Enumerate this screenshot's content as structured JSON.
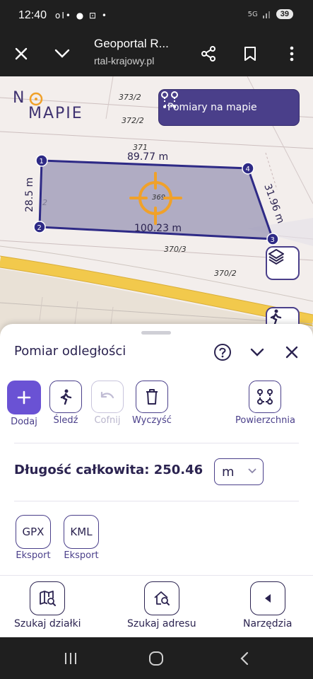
{
  "status_bar": {
    "time": "12:40",
    "left_icons": "oI• ● ⊡ •",
    "signal": "5G",
    "battery": "39"
  },
  "browser": {
    "title": "Geoportal R...",
    "url": "rtal-krajowy.pl",
    "icons": [
      "close-icon",
      "chevron-down-icon",
      "share-icon",
      "bookmark-icon",
      "more-icon"
    ]
  },
  "map": {
    "logo_n": "N",
    "logo_mapie": "MAPIE",
    "measure_button": "Pomiary na mapie",
    "parcel_labels": [
      "373/2",
      "372/2",
      "371",
      "369",
      "370/3",
      "370/2",
      "2"
    ],
    "edge_labels": [
      "89.77 m",
      "31.96 m",
      "100.23 m",
      "28.5 m"
    ],
    "vertex_labels": [
      "1",
      "2",
      "3",
      "4"
    ],
    "colors": {
      "polygon_fill": "#9a96b6",
      "polygon_stroke": "#2e2a86",
      "crosshair": "#f0a12a"
    }
  },
  "sheet": {
    "title": "Pomiar odległości",
    "tools": [
      {
        "label": "Dodaj",
        "icon": "plus-icon"
      },
      {
        "label": "Śledź",
        "icon": "walk-icon"
      },
      {
        "label": "Cofnij",
        "icon": "undo-icon"
      },
      {
        "label": "Wyczyść",
        "icon": "trash-icon"
      },
      {
        "label": "Powierzchnia",
        "icon": "area-icon"
      }
    ],
    "total_label": "Długość całkowita: 250.46",
    "unit": "m",
    "exports": [
      {
        "box": "GPX",
        "label": "Eksport"
      },
      {
        "box": "KML",
        "label": "Eksport"
      }
    ]
  },
  "bottom_nav": [
    {
      "label": "Szukaj działki",
      "icon": "parcel-search-icon"
    },
    {
      "label": "Szukaj adresu",
      "icon": "address-search-icon"
    },
    {
      "label": "Narzędzia",
      "icon": "tools-icon"
    }
  ]
}
